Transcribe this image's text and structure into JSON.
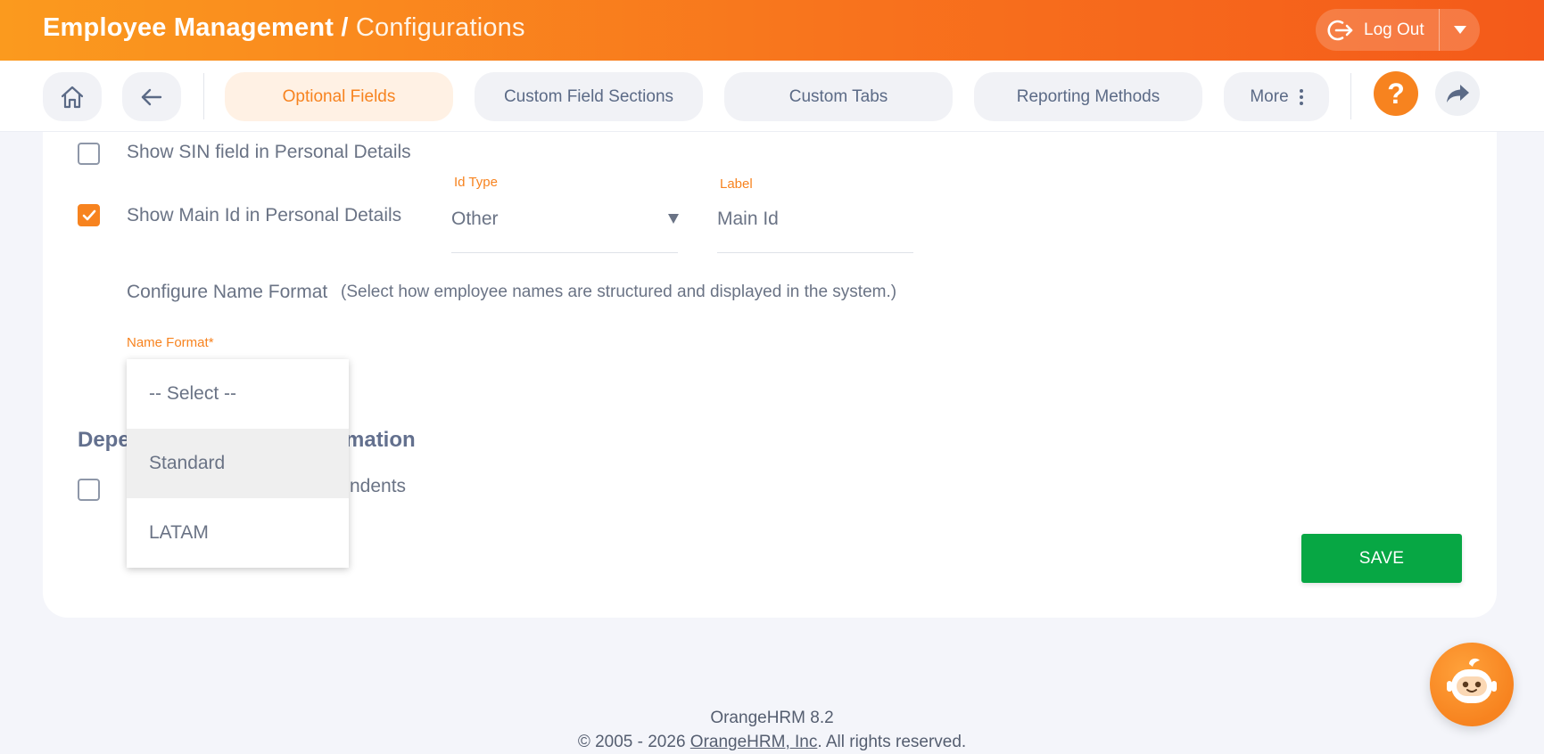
{
  "header": {
    "title": "Employee Management",
    "separator": " / ",
    "subtitle": "Configurations",
    "logout_label": "Log Out"
  },
  "nav": {
    "tabs": [
      {
        "label": "Optional Fields",
        "active": true
      },
      {
        "label": "Custom Field Sections",
        "active": false
      },
      {
        "label": "Custom Tabs",
        "active": false
      },
      {
        "label": "Reporting Methods",
        "active": false
      }
    ],
    "more_label": "More",
    "help_label": "?"
  },
  "form": {
    "sin_checkbox": {
      "label": "Show SIN field in Personal Details",
      "checked": false
    },
    "main_id_checkbox": {
      "label": "Show Main Id in Personal Details",
      "checked": true
    },
    "id_type": {
      "label": "Id Type",
      "value": "Other"
    },
    "id_label": {
      "label": "Label",
      "value": "Main Id"
    },
    "name_format_title": "Configure Name Format",
    "name_format_hint": "(Select how employee names are structured and displayed in the system.)",
    "name_format_label": "Name Format",
    "required_mark": "*",
    "name_format_options": [
      "-- Select --",
      "Standard",
      "LATAM"
    ],
    "dependents_section_visible_start": "Depe",
    "dependents_section_visible_end": "mation",
    "dependents_checkbox_visible_end": "ndents",
    "save_label": "SAVE"
  },
  "footer": {
    "version": "OrangeHRM 8.2",
    "copyright_prefix": "© 2005 - 2026 ",
    "company_link": "OrangeHRM, Inc",
    "copyright_suffix": ". All rights reserved."
  },
  "colors": {
    "accent": "#f7831f",
    "save_green": "#07a744"
  }
}
